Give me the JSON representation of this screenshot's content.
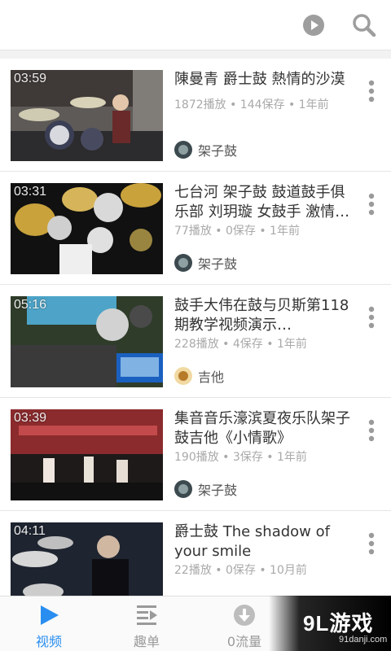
{
  "videos": [
    {
      "duration": "03:59",
      "title": "陳曼青 爵士鼓 熱情的沙漠",
      "meta": "1872播放 • 144保存 • 1年前",
      "author": "架子鼓"
    },
    {
      "duration": "03:31",
      "title": "七台河 架子鼓 鼓道鼓手俱乐部 刘玥璇 女鼓手 激情…",
      "meta": "77播放 • 0保存 • 1年前",
      "author": "架子鼓"
    },
    {
      "duration": "05:16",
      "title": "鼓手大伟在鼓与贝斯第118期教学视频演示…",
      "meta": "228播放 • 4保存 • 1年前",
      "author": "吉他"
    },
    {
      "duration": "03:39",
      "title": "集音音乐濠滨夏夜乐队架子鼓吉他《小情歌》",
      "meta": "190播放 • 3保存 • 1年前",
      "author": "架子鼓"
    },
    {
      "duration": "04:11",
      "title": "爵士鼓 The shadow of your smile",
      "meta": "22播放 • 0保存 • 10月前",
      "author": "架子鼓"
    }
  ],
  "tabs": [
    "视频",
    "趣单",
    "0流量",
    ""
  ],
  "watermark": {
    "logo": "9L游戏",
    "url": "91danji.com"
  },
  "colors": {
    "accent": "#2a8ef0",
    "icon_gray": "#9a9a9a"
  }
}
